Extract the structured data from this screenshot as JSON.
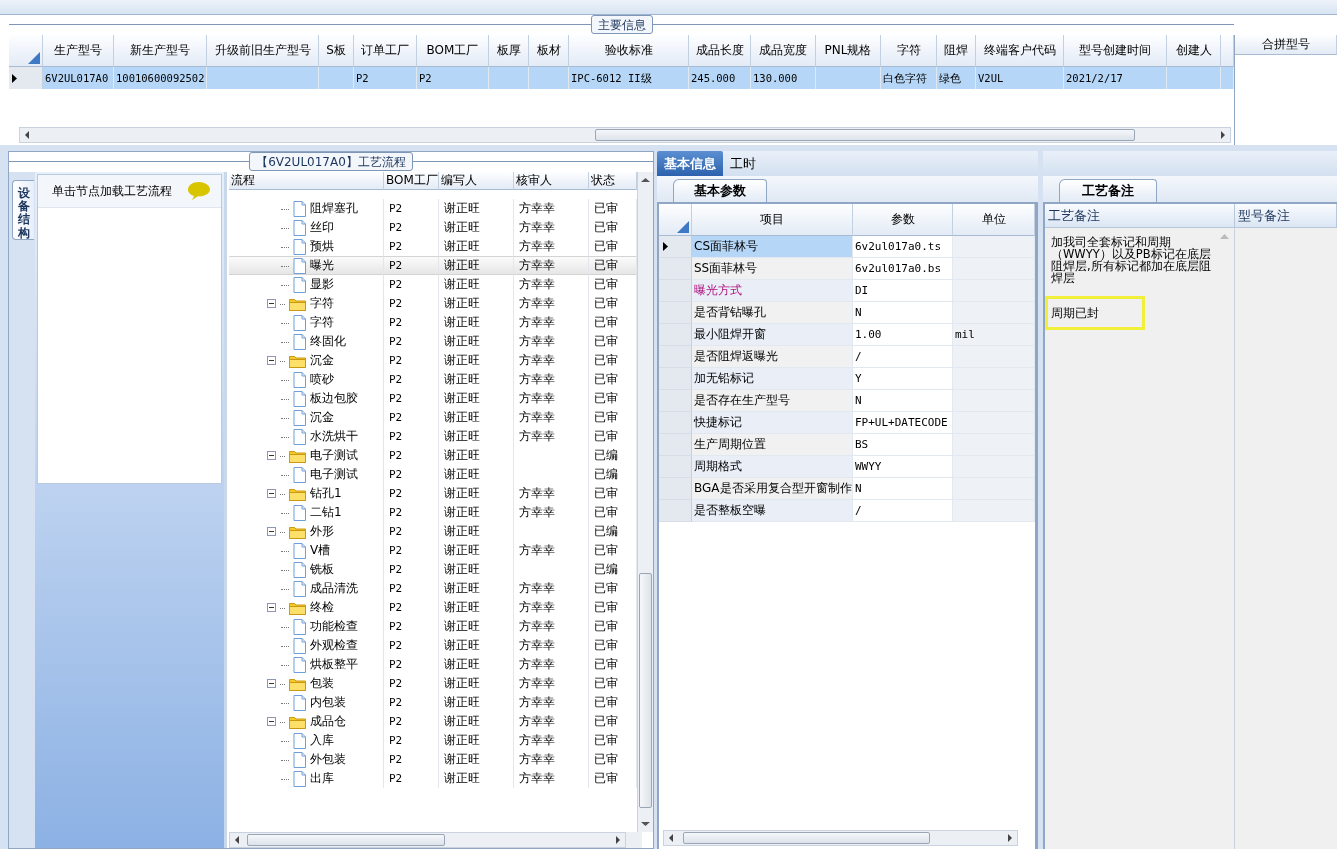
{
  "main_info": {
    "title": "主要信息",
    "columns": [
      "生产型号",
      "新生产型号",
      "升级前旧生产型号",
      "S板",
      "订单工厂",
      "BOM工厂",
      "板厚",
      "板材",
      "验收标准",
      "成品长度",
      "成品宽度",
      "PNL规格",
      "字符",
      "阻焊",
      "终端客户代码",
      "型号创建时间",
      "创建人"
    ],
    "rows": [
      {
        "selected": true,
        "cells": [
          "6V2UL017A0",
          "10010600092502",
          null,
          null,
          "P2",
          "P2",
          null,
          null,
          "IPC-6012 II级",
          "245.000",
          "130.000",
          null,
          "白色字符",
          "绿色",
          "V2UL",
          "2021/2/17",
          null
        ]
      }
    ],
    "merge_panel": {
      "title": "合拼型号"
    }
  },
  "flow": {
    "title": "【6V2UL017A0】工艺流程",
    "side_tab": {
      "label": "设备结构",
      "selected": true
    },
    "hint": "单击节点加载工艺流程",
    "columns": [
      "流程",
      "BOM工厂",
      "编写人",
      "核审人",
      "状态"
    ],
    "tree": [
      {
        "children": [
          {
            "name": "阻焊塞孔",
            "bom": "P2",
            "writer": "谢正旺",
            "reviewer": "方幸幸",
            "status": "已审",
            "selected": false
          },
          {
            "name": "丝印",
            "bom": "P2",
            "writer": "谢正旺",
            "reviewer": "方幸幸",
            "status": "已审",
            "selected": false
          },
          {
            "name": "预烘",
            "bom": "P2",
            "writer": "谢正旺",
            "reviewer": "方幸幸",
            "status": "已审",
            "selected": false
          },
          {
            "name": "曝光",
            "bom": "P2",
            "writer": "谢正旺",
            "reviewer": "方幸幸",
            "status": "已审",
            "selected": true
          },
          {
            "name": "显影",
            "bom": "P2",
            "writer": "谢正旺",
            "reviewer": "方幸幸",
            "status": "已审",
            "selected": false
          }
        ]
      },
      {
        "name": "字符",
        "bom": "P2",
        "writer": "谢正旺",
        "reviewer": "方幸幸",
        "status": "已审",
        "expanded": true,
        "selected": false,
        "children": [
          {
            "name": "字符",
            "bom": "P2",
            "writer": "谢正旺",
            "reviewer": "方幸幸",
            "status": "已审",
            "selected": false
          },
          {
            "name": "终固化",
            "bom": "P2",
            "writer": "谢正旺",
            "reviewer": "方幸幸",
            "status": "已审",
            "selected": false
          }
        ]
      },
      {
        "name": "沉金",
        "bom": "P2",
        "writer": "谢正旺",
        "reviewer": "方幸幸",
        "status": "已审",
        "expanded": true,
        "selected": false,
        "children": [
          {
            "name": "喷砂",
            "bom": "P2",
            "writer": "谢正旺",
            "reviewer": "方幸幸",
            "status": "已审",
            "selected": false
          },
          {
            "name": "板边包胶",
            "bom": "P2",
            "writer": "谢正旺",
            "reviewer": "方幸幸",
            "status": "已审",
            "selected": false
          },
          {
            "name": "沉金",
            "bom": "P2",
            "writer": "谢正旺",
            "reviewer": "方幸幸",
            "status": "已审",
            "selected": false
          },
          {
            "name": "水洗烘干",
            "bom": "P2",
            "writer": "谢正旺",
            "reviewer": "方幸幸",
            "status": "已审",
            "selected": false
          }
        ]
      },
      {
        "name": "电子测试",
        "bom": "P2",
        "writer": "谢正旺",
        "status": "已编",
        "expanded": true,
        "selected": false,
        "children": [
          {
            "name": "电子测试",
            "bom": "P2",
            "writer": "谢正旺",
            "status": "已编",
            "selected": false
          }
        ]
      },
      {
        "name": "钻孔1",
        "bom": "P2",
        "writer": "谢正旺",
        "reviewer": "方幸幸",
        "status": "已审",
        "expanded": true,
        "selected": false,
        "children": [
          {
            "name": "二钻1",
            "bom": "P2",
            "writer": "谢正旺",
            "reviewer": "方幸幸",
            "status": "已审",
            "selected": false
          }
        ]
      },
      {
        "name": "外形",
        "bom": "P2",
        "writer": "谢正旺",
        "status": "已编",
        "expanded": true,
        "selected": false,
        "children": [
          {
            "name": "V槽",
            "bom": "P2",
            "writer": "谢正旺",
            "reviewer": "方幸幸",
            "status": "已审",
            "selected": false
          },
          {
            "name": "铣板",
            "bom": "P2",
            "writer": "谢正旺",
            "status": "已编",
            "selected": false
          },
          {
            "name": "成品清洗",
            "bom": "P2",
            "writer": "谢正旺",
            "reviewer": "方幸幸",
            "status": "已审",
            "selected": false
          }
        ]
      },
      {
        "name": "终检",
        "bom": "P2",
        "writer": "谢正旺",
        "reviewer": "方幸幸",
        "status": "已审",
        "expanded": true,
        "selected": false,
        "children": [
          {
            "name": "功能检查",
            "bom": "P2",
            "writer": "谢正旺",
            "reviewer": "方幸幸",
            "status": "已审",
            "selected": false
          },
          {
            "name": "外观检查",
            "bom": "P2",
            "writer": "谢正旺",
            "reviewer": "方幸幸",
            "status": "已审",
            "selected": false
          },
          {
            "name": "烘板整平",
            "bom": "P2",
            "writer": "谢正旺",
            "reviewer": "方幸幸",
            "status": "已审",
            "selected": false
          }
        ]
      },
      {
        "name": "包装",
        "bom": "P2",
        "writer": "谢正旺",
        "reviewer": "方幸幸",
        "status": "已审",
        "expanded": true,
        "selected": false,
        "children": [
          {
            "name": "内包装",
            "bom": "P2",
            "writer": "谢正旺",
            "reviewer": "方幸幸",
            "status": "已审",
            "selected": false
          }
        ]
      },
      {
        "name": "成品仓",
        "bom": "P2",
        "writer": "谢正旺",
        "reviewer": "方幸幸",
        "status": "已审",
        "expanded": true,
        "selected": false,
        "children": [
          {
            "name": "入库",
            "bom": "P2",
            "writer": "谢正旺",
            "reviewer": "方幸幸",
            "status": "已审",
            "selected": false
          },
          {
            "name": "外包装",
            "bom": "P2",
            "writer": "谢正旺",
            "reviewer": "方幸幸",
            "status": "已审",
            "selected": false
          },
          {
            "name": "出库",
            "bom": "P2",
            "writer": "谢正旺",
            "reviewer": "方幸幸",
            "status": "已审",
            "selected": false
          }
        ]
      }
    ]
  },
  "details": {
    "tabs": [
      {
        "label": "基本信息",
        "selected": true
      },
      {
        "label": "工时",
        "selected": false
      }
    ],
    "section_tab": "基本参数",
    "columns": [
      "项目",
      "参数",
      "单位"
    ],
    "rows": [
      {
        "item": "CS面菲林号",
        "value": "6v2ul017a0.ts",
        "selected": true,
        "highlighted": false
      },
      {
        "item": "SS面菲林号",
        "value": "6v2ul017a0.bs",
        "selected": false,
        "highlighted": false
      },
      {
        "item": "曝光方式",
        "value": "DI",
        "selected": false,
        "highlighted": true
      },
      {
        "item": "是否背钻曝孔",
        "value": "N",
        "selected": false,
        "highlighted": false
      },
      {
        "item": "最小阻焊开窗",
        "value": "1.00",
        "unit": "mil",
        "selected": false,
        "highlighted": false
      },
      {
        "item": "是否阻焊返曝光",
        "value": "/",
        "selected": false,
        "highlighted": false
      },
      {
        "item": "加无铅标记",
        "value": "Y",
        "selected": false,
        "highlighted": false
      },
      {
        "item": "是否存在生产型号",
        "value": "N",
        "selected": false,
        "highlighted": false
      },
      {
        "item": "快捷标记",
        "value": "FP+UL+DATECODE",
        "selected": false,
        "highlighted": false
      },
      {
        "item": "生产周期位置",
        "value": "BS",
        "selected": false,
        "highlighted": false
      },
      {
        "item": "周期格式",
        "value": "WWYY",
        "selected": false,
        "highlighted": false
      },
      {
        "item": "BGA是否采用复合型开窗制作",
        "value": "N",
        "selected": false,
        "highlighted": false
      },
      {
        "item": "是否整板空曝",
        "value": "/",
        "selected": false,
        "highlighted": false
      }
    ]
  },
  "notes": {
    "tab": "工艺备注",
    "columns": [
      "工艺备注",
      "型号备注"
    ],
    "paragraphs": [
      {
        "text": "加我司全套标记和周期（WWYY）以及PB标记在底层阻焊层,所有标记都加在底层阻焊层",
        "highlighted": false
      },
      {
        "text": "周期已封",
        "highlighted": true
      }
    ]
  }
}
